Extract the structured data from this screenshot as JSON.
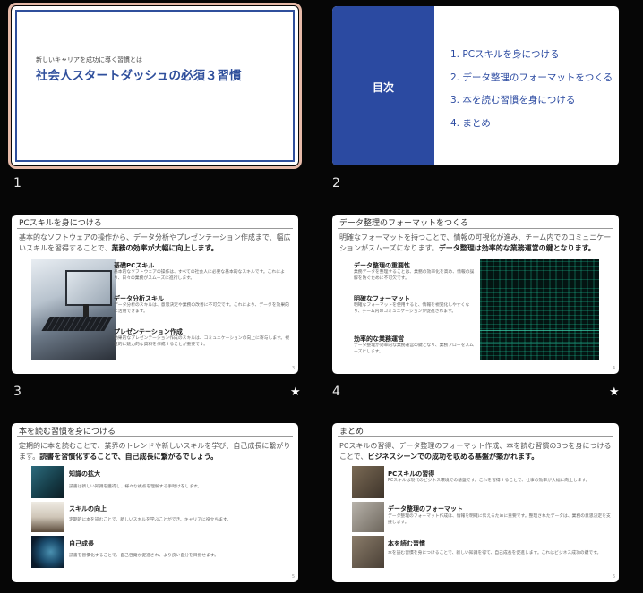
{
  "slides": [
    {
      "number": "1",
      "subtitle": "新しいキャリアを成功に導く習慣とは",
      "title": "社会人スタートダッシュの必須３習慣"
    },
    {
      "number": "2",
      "toc_heading": "目次",
      "toc_items": [
        "1.  PCスキルを身につける",
        "2.  データ整理のフォーマットをつくる",
        "3.  本を読む習慣を身につける",
        "4.  まとめ"
      ]
    },
    {
      "number": "3",
      "header": "PCスキルを身につける",
      "intro_plain": "基本的なソフトウェアの操作から、データ分析やプレゼンテーション作成まで、幅広いスキルを習得することで、",
      "intro_bold": "業務の効率が大幅に向上します。",
      "items": [
        {
          "title": "基礎PCスキル",
          "text": "基本的なソフトウェアの操作は、すべての社会人に必要な基本的なスキルです。これにより、日々の業務がスムーズに進行します。"
        },
        {
          "title": "データ分析スキル",
          "text": "データ分析のスキルは、意思決定や業務の改善に不可欠です。これにより、データを効果的に活用できます。"
        },
        {
          "title": "プレゼンテーション作成",
          "text": "効果的なプレゼンテーション作成のスキルは、コミュニケーションの向上に寄与します。視覚的に魅力的な資料を作成することが重要です。"
        }
      ],
      "page": "3",
      "star": "★"
    },
    {
      "number": "4",
      "header": "データ整理のフォーマットをつくる",
      "intro_plain": "明確なフォーマットを持つことで、情報の可視化が進み、チーム内でのコミュニケーションがスムーズになります。",
      "intro_bold": "データ整理は効率的な業務運営の鍵となります。",
      "items": [
        {
          "title": "データ整理の重要性",
          "text": "業務データを整理することは、業務の効率化を高め、情報の誤解を防ぐために不可欠です。"
        },
        {
          "title": "明確なフォーマット",
          "text": "明確なフォーマットを使用すると、情報を視覚化しやすくなり、チーム内のコミュニケーションが促進されます。"
        },
        {
          "title": "効率的な業務運営",
          "text": "データ整理が効率的な業務運営の鍵となり、業務フローをスムーズにします。"
        }
      ],
      "page": "4",
      "star": "★"
    },
    {
      "number": "5",
      "header": "本を読む習慣を身につける",
      "intro_plain": "定期的に本を読むことで、業界のトレンドや新しいスキルを学び、自己成長に繋がります。",
      "intro_bold": "読書を習慣化することで、自己成長に繋がるでしょう。",
      "items": [
        {
          "title": "知識の拡大",
          "text": "読書は新しい知識を獲得し、様々な視点を理解する手助けをします。"
        },
        {
          "title": "スキルの向上",
          "text": "定期的に本を読むことで、新しいスキルを学ぶことができ、キャリアに役立ちます。"
        },
        {
          "title": "自己成長",
          "text": "読書を習慣化することで、自己啓発が促進され、より良い自分を目指せます。"
        }
      ],
      "page": "5"
    },
    {
      "number": "6",
      "header": "まとめ",
      "intro_plain": "PCスキルの習得、データ整理のフォーマット作成、本を読む習慣の3つを身につけることで、",
      "intro_bold": "ビジネスシーンでの成功を収める基盤が築かれます。",
      "items": [
        {
          "title": "PCスキルの習得",
          "text": "PCスキルは現代のビジネス環境での基盤です。これを習得することで、仕事の効率が大幅に向上します。"
        },
        {
          "title": "データ整理のフォーマット",
          "text": "データ整理のフォーマット作成は、情報を明確に伝えるために重要です。整理されたデータは、業務の意思決定を支援します。"
        },
        {
          "title": "本を読む習慣",
          "text": "本を読む習慣を身につけることで、新しい知識を得て、自己成長を促進します。これはビジネス成功の鍵です。"
        }
      ],
      "page": "6"
    }
  ],
  "colors": {
    "background": "#060606",
    "accent_blue": "#2b4aa1",
    "selection": "#e6b9a8"
  }
}
